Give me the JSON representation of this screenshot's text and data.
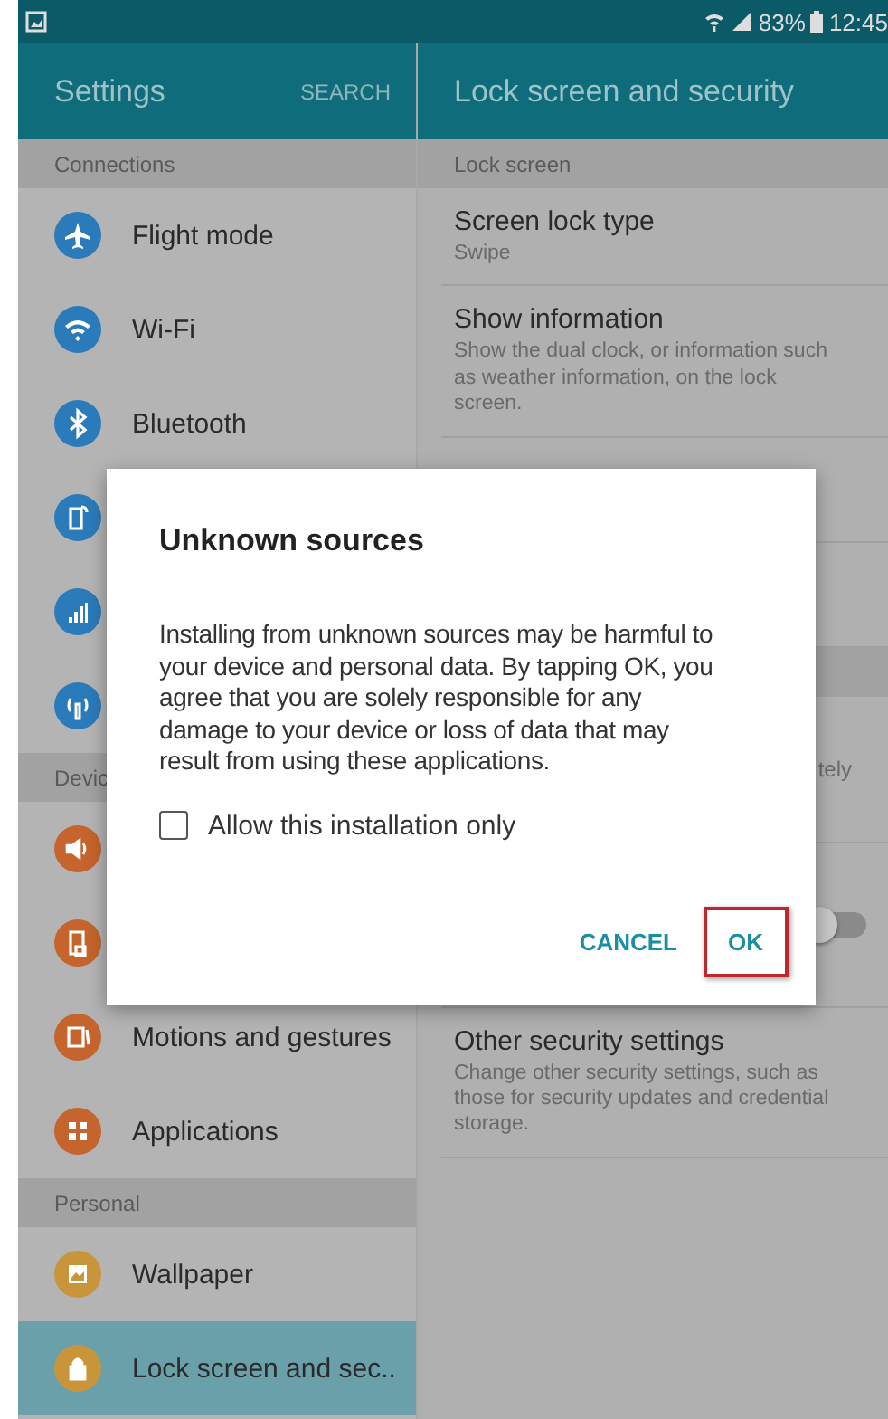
{
  "status_bar": {
    "battery": "83%",
    "time": "12:45"
  },
  "header": {
    "title": "Settings",
    "search": "SEARCH",
    "detail_title": "Lock screen and security"
  },
  "sidebar": [
    {
      "kind": "section",
      "label": "Connections"
    },
    {
      "kind": "item",
      "label": "Flight mode",
      "color": "#2b7bbb",
      "selected": false
    },
    {
      "kind": "item",
      "label": "Wi-Fi",
      "color": "#2b7bbb",
      "selected": false
    },
    {
      "kind": "item",
      "label": "Bluetooth",
      "color": "#2b7bbb",
      "selected": false
    },
    {
      "kind": "item",
      "color": "#2b7bbb",
      "selected": false
    },
    {
      "kind": "item",
      "color": "#2b7bbb",
      "selected": false
    },
    {
      "kind": "item",
      "color": "#2b7bbb",
      "selected": false
    },
    {
      "kind": "section",
      "label": "Devic"
    },
    {
      "kind": "item",
      "color": "#c5642c",
      "selected": false
    },
    {
      "kind": "item",
      "color": "#c5642c",
      "selected": false
    },
    {
      "kind": "item",
      "label": "Motions and gestures",
      "color": "#c5642c",
      "selected": false
    },
    {
      "kind": "item",
      "label": "Applications",
      "color": "#c5642c",
      "selected": false
    },
    {
      "kind": "section",
      "label": "Personal"
    },
    {
      "kind": "item",
      "label": "Wallpaper",
      "color": "#c8953a",
      "selected": false
    },
    {
      "kind": "item",
      "label": "Lock screen and sec..",
      "color": "#c8953a",
      "selected": true
    }
  ],
  "detail": [
    {
      "kind": "section",
      "label": "Lock screen"
    },
    {
      "kind": "item",
      "title": "Screen lock type",
      "subtitle": "Swipe"
    },
    {
      "kind": "item",
      "title": "Show information",
      "subtitle": "Show the dual clock, or information such as weather information, on the lock screen."
    },
    {
      "kind": "blank"
    },
    {
      "kind": "blank"
    },
    {
      "kind": "section"
    },
    {
      "kind": "fragment",
      "text": "tely"
    },
    {
      "kind": "toggle",
      "on": false
    },
    {
      "kind": "item",
      "title": "Other security settings",
      "subtitle": "Change other security settings, such as those for security updates and credential storage."
    }
  ],
  "dialog": {
    "title": "Unknown sources",
    "body": "Installing from unknown sources may be harmful to your device and personal data. By tapping OK, you agree that you are solely responsible for any damage to your device or loss of data that may result from using these applications.",
    "checkbox": {
      "label": "Allow this installation only",
      "checked": false
    },
    "buttons": [
      {
        "label": "CANCEL",
        "highlighted": false
      },
      {
        "label": "OK",
        "highlighted": true
      }
    ]
  }
}
